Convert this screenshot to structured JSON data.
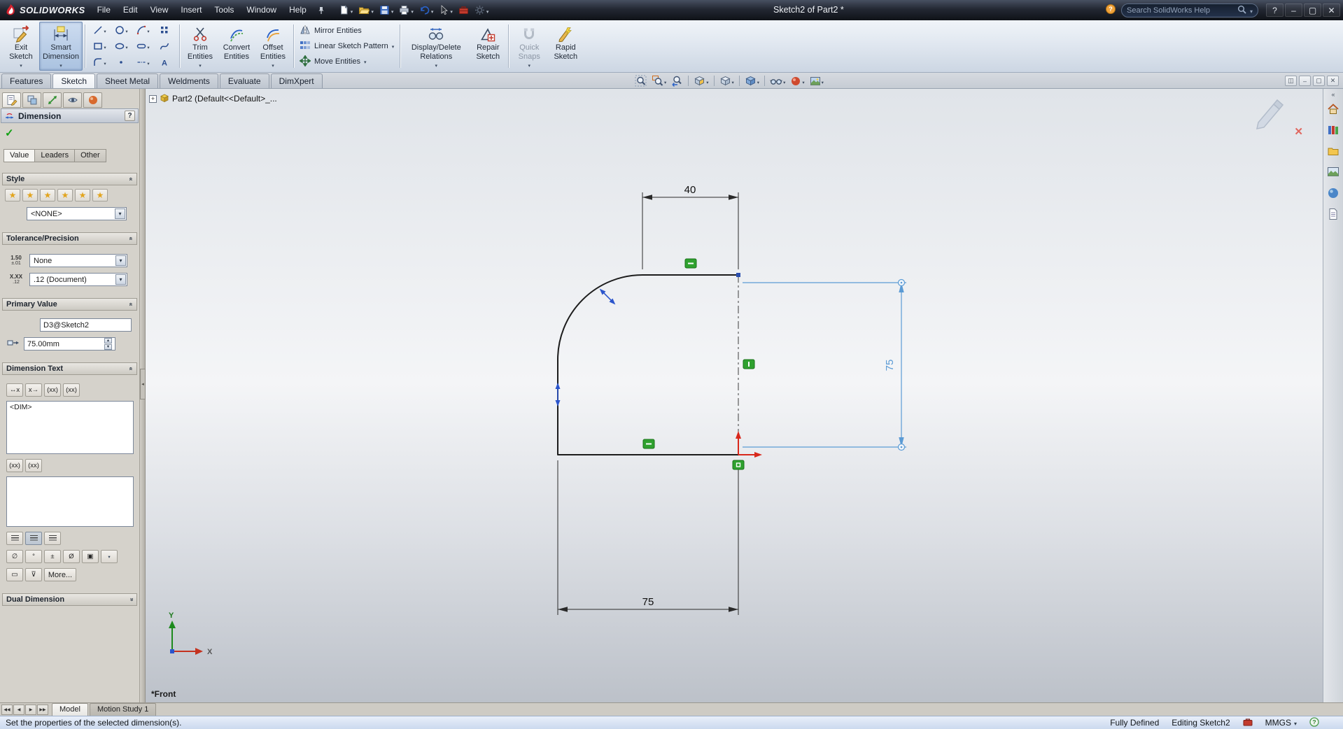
{
  "colors": {
    "selection_blue": "#5b9bd5",
    "constraint_green": "#2fa12f",
    "origin_red": "#d8281c",
    "geometry_black": "#1c1c1c"
  },
  "title_bar": {
    "logo_text": "SOLIDWORKS",
    "menus": [
      "File",
      "Edit",
      "View",
      "Insert",
      "Tools",
      "Window",
      "Help"
    ],
    "quick_tools": [
      {
        "name": "file-new",
        "arrow": true
      },
      {
        "name": "open",
        "arrow": true
      },
      {
        "name": "save",
        "arrow": true
      },
      {
        "name": "print",
        "arrow": true
      },
      {
        "name": "undo",
        "arrow": true
      },
      {
        "name": "select-cursor",
        "arrow": true
      },
      {
        "name": "toolbox",
        "arrow": false
      },
      {
        "name": "options",
        "arrow": true
      }
    ],
    "doc_title": "Sketch2 of Part2 *",
    "search": {
      "placeholder": "Search SolidWorks Help"
    },
    "window_controls": [
      {
        "name": "help",
        "glyph": "?"
      },
      {
        "name": "minimize",
        "glyph": "–"
      },
      {
        "name": "maximize",
        "glyph": "▢"
      },
      {
        "name": "close",
        "glyph": "✕"
      }
    ]
  },
  "ribbon": {
    "exit_sketch": [
      "Exit",
      "Sketch"
    ],
    "smart_dimension": [
      "Smart",
      "Dimension"
    ],
    "sketch_tools": [
      {
        "name": "line",
        "arrow": true
      },
      {
        "name": "circle",
        "arrow": true
      },
      {
        "name": "arc",
        "arrow": true
      },
      {
        "name": "pattern",
        "arrow": false
      },
      {
        "name": "rectangle",
        "arrow": true
      },
      {
        "name": "ellipse",
        "arrow": true
      },
      {
        "name": "slot",
        "arrow": true
      },
      {
        "name": "spline",
        "arrow": false
      },
      {
        "name": "fillet",
        "arrow": true
      },
      {
        "name": "point",
        "arrow": false
      },
      {
        "name": "centerline",
        "arrow": true
      },
      {
        "name": "text-tool",
        "arrow": false
      }
    ],
    "trim": [
      "Trim",
      "Entities"
    ],
    "convert": [
      "Convert",
      "Entities"
    ],
    "offset": [
      "Offset",
      "Entities"
    ],
    "stacked": [
      {
        "name": "mirror",
        "label": "Mirror Entities",
        "arrow": false
      },
      {
        "name": "linear-pattern",
        "label": "Linear Sketch Pattern",
        "arrow": true
      },
      {
        "name": "move",
        "label": "Move Entities",
        "arrow": true
      }
    ],
    "display_delete": [
      "Display/Delete",
      "Relations"
    ],
    "repair": [
      "Repair",
      "Sketch"
    ],
    "quick_snaps": [
      "Quick",
      "Snaps"
    ],
    "rapid": [
      "Rapid",
      "Sketch"
    ]
  },
  "command_tabs": {
    "items": [
      "Features",
      "Sketch",
      "Sheet Metal",
      "Weldments",
      "Evaluate",
      "DimXpert"
    ],
    "active_index": 1
  },
  "hud": [
    {
      "name": "zoom-fit"
    },
    {
      "name": "zoom-area",
      "arrow": true
    },
    {
      "name": "zoom-previous"
    },
    {
      "sep": true
    },
    {
      "name": "section-view",
      "arrow": true
    },
    {
      "sep": true
    },
    {
      "name": "view-orientation",
      "arrow": true
    },
    {
      "sep": true
    },
    {
      "name": "display-style",
      "arrow": true
    },
    {
      "sep": true
    },
    {
      "name": "hide-show",
      "arrow": true
    },
    {
      "name": "edit-appearance",
      "arrow": true
    },
    {
      "name": "apply-scene",
      "arrow": true
    }
  ],
  "doc_window_controls": [
    {
      "name": "doc-split",
      "glyph": "◫"
    },
    {
      "name": "doc-minimize",
      "glyph": "–"
    },
    {
      "name": "doc-restore",
      "glyph": "▢"
    },
    {
      "name": "doc-close",
      "glyph": "✕"
    }
  ],
  "property_manager": {
    "panel_tabs": [
      "pm-pm",
      "pm-config",
      "pm-dimxpert",
      "pm-display",
      "pm-appearance"
    ],
    "title": "Dimension",
    "help_glyph": "?",
    "ok_glyph": "✓",
    "tabs": [
      "Value",
      "Leaders",
      "Other"
    ],
    "active_tab": "Value",
    "style": {
      "title": "Style",
      "buttons": [
        "set-default-style",
        "add-favorite",
        "update-favorite",
        "delete-favorite",
        "save-favorite",
        "load-favorite"
      ],
      "selected": "<NONE>"
    },
    "tolerance": {
      "title": "Tolerance/Precision",
      "tol_icon": [
        "1.50",
        "±.01"
      ],
      "tolerance": "None",
      "prec_icon": [
        "X.XX",
        ".12"
      ],
      "precision": ".12 (Document)"
    },
    "primary": {
      "title": "Primary Value",
      "name": "D3@Sketch2",
      "value": "75.00mm"
    },
    "dim_text": {
      "title": "Dimension Text",
      "position_buttons": [
        "↔x",
        "x→",
        "(xx)",
        "(xx)"
      ],
      "value": "<DIM>",
      "xx_buttons": [
        "(xx)",
        "(xx)"
      ],
      "symbol_buttons": [
        "∅",
        "°",
        "±",
        "Ø",
        "▣"
      ],
      "more_label": "More..."
    },
    "dual": {
      "title": "Dual Dimension"
    }
  },
  "viewport": {
    "tree_item": "Part2 (Default<<Default>_...",
    "dimensions": {
      "top": "40",
      "right": "75",
      "bottom": "75"
    },
    "axis_x": "X",
    "axis_y": "Y",
    "front_label": "*Front"
  },
  "task_pane": {
    "items": [
      "tp-resources",
      "tp-library",
      "tp-explorer",
      "tp-view-palette",
      "tp-appearances",
      "tp-custom-props"
    ]
  },
  "bottom_tabs": {
    "nav": [
      {
        "name": "rewind",
        "glyph": "◀◀"
      },
      {
        "name": "previous",
        "glyph": "◀"
      },
      {
        "name": "next",
        "glyph": "▶"
      },
      {
        "name": "forward",
        "glyph": "▶▶"
      }
    ],
    "items": [
      "Model",
      "Motion Study 1"
    ],
    "active_index": 0
  },
  "status_bar": {
    "message": "Set the properties of the selected dimension(s).",
    "state": "Fully Defined",
    "editing": "Editing Sketch2",
    "units": "MMGS"
  }
}
